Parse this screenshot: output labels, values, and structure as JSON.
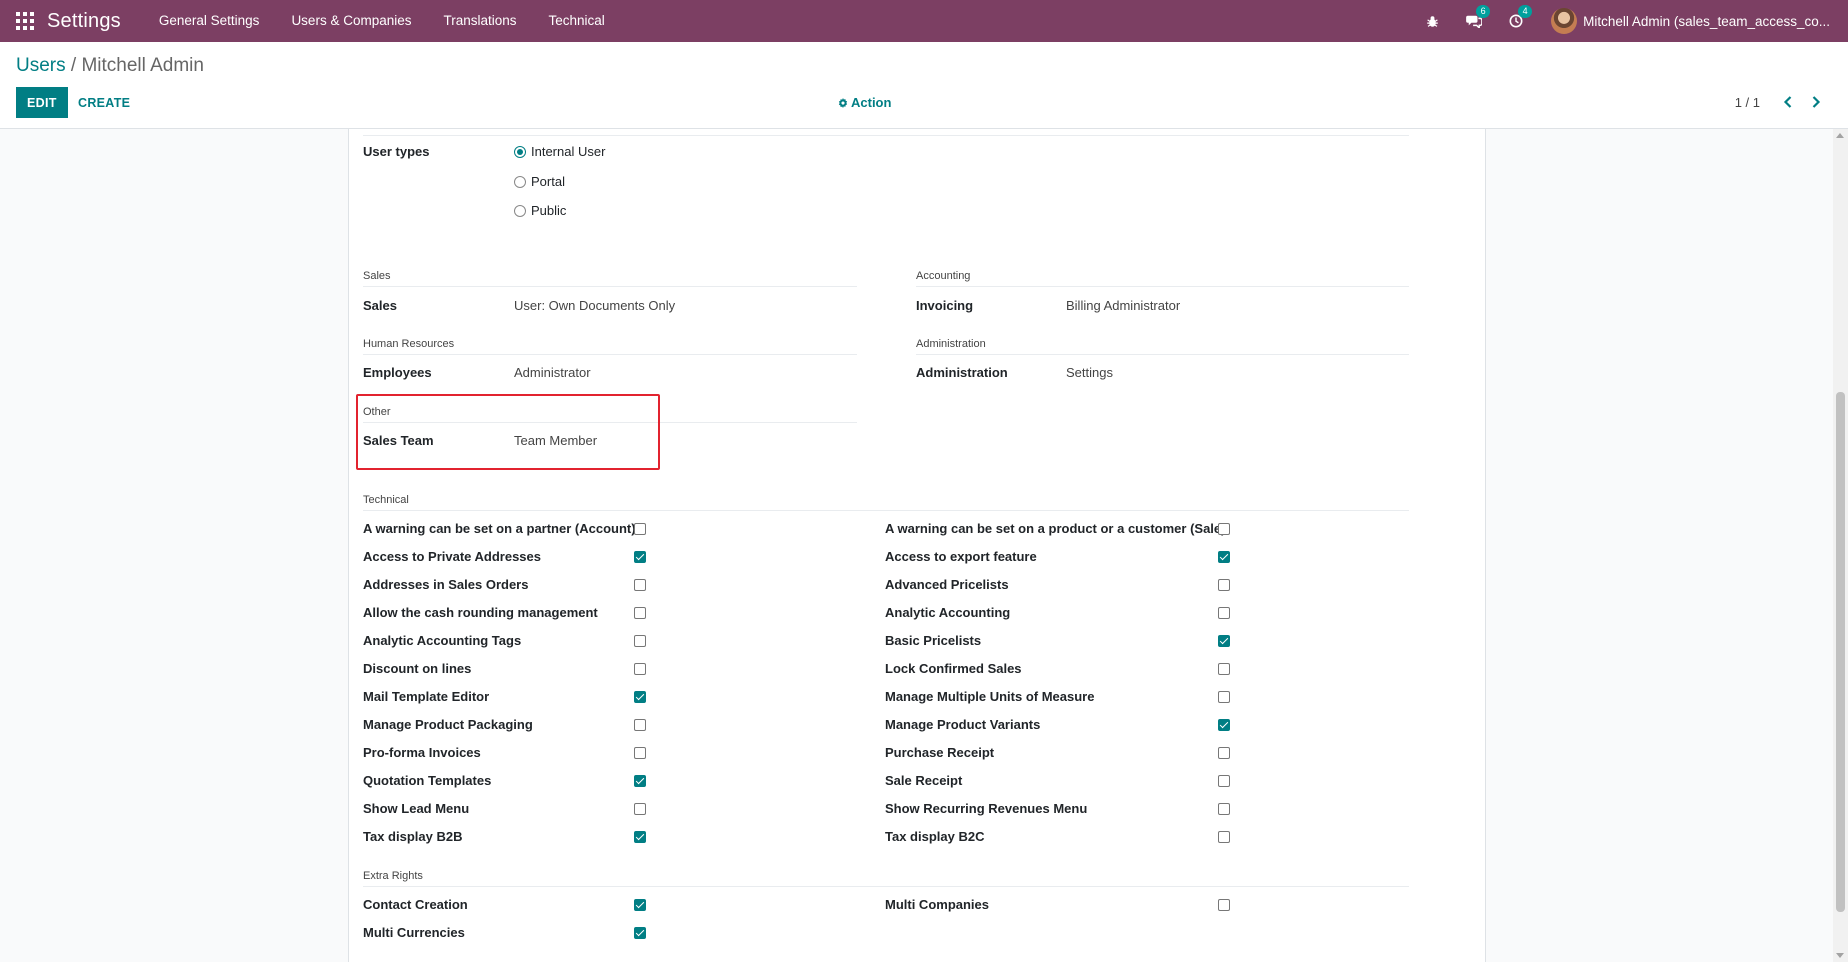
{
  "navbar": {
    "app_title": "Settings",
    "menu": [
      "General Settings",
      "Users & Companies",
      "Translations",
      "Technical"
    ],
    "chat_count": "6",
    "activity_count": "4",
    "user_name": "Mitchell Admin (sales_team_access_co..."
  },
  "control_panel": {
    "breadcrumb_parent": "Users",
    "breadcrumb_separator": " / ",
    "breadcrumb_current": "Mitchell Admin",
    "edit_label": "EDIT",
    "create_label": "CREATE",
    "action_label": "Action",
    "pager": "1 / 1"
  },
  "form": {
    "user_types": {
      "label": "User types",
      "options": [
        {
          "label": "Internal User",
          "checked": true
        },
        {
          "label": "Portal",
          "checked": false
        },
        {
          "label": "Public",
          "checked": false
        }
      ]
    },
    "groups": {
      "sales": {
        "title": "Sales",
        "label": "Sales",
        "value": "User: Own Documents Only"
      },
      "accounting": {
        "title": "Accounting",
        "label": "Invoicing",
        "value": "Billing Administrator"
      },
      "hr": {
        "title": "Human Resources",
        "label": "Employees",
        "value": "Administrator"
      },
      "administration": {
        "title": "Administration",
        "label": "Administration",
        "value": "Settings"
      },
      "other": {
        "title": "Other",
        "label": "Sales Team",
        "value": "Team Member"
      }
    },
    "technical": {
      "title": "Technical",
      "left": [
        {
          "label": "A warning can be set on a partner (Account)",
          "checked": false
        },
        {
          "label": "Access to Private Addresses",
          "checked": true
        },
        {
          "label": "Addresses in Sales Orders",
          "checked": false
        },
        {
          "label": "Allow the cash rounding management",
          "checked": false
        },
        {
          "label": "Analytic Accounting Tags",
          "checked": false
        },
        {
          "label": "Discount on lines",
          "checked": false
        },
        {
          "label": "Mail Template Editor",
          "checked": true
        },
        {
          "label": "Manage Product Packaging",
          "checked": false
        },
        {
          "label": "Pro-forma Invoices",
          "checked": false
        },
        {
          "label": "Quotation Templates",
          "checked": true
        },
        {
          "label": "Show Lead Menu",
          "checked": false
        },
        {
          "label": "Tax display B2B",
          "checked": true
        }
      ],
      "right": [
        {
          "label": "A warning can be set on a product or a customer (Sale)",
          "checked": false
        },
        {
          "label": "Access to export feature",
          "checked": true
        },
        {
          "label": "Advanced Pricelists",
          "checked": false
        },
        {
          "label": "Analytic Accounting",
          "checked": false
        },
        {
          "label": "Basic Pricelists",
          "checked": true
        },
        {
          "label": "Lock Confirmed Sales",
          "checked": false
        },
        {
          "label": "Manage Multiple Units of Measure",
          "checked": false
        },
        {
          "label": "Manage Product Variants",
          "checked": true
        },
        {
          "label": "Purchase Receipt",
          "checked": false
        },
        {
          "label": "Sale Receipt",
          "checked": false
        },
        {
          "label": "Show Recurring Revenues Menu",
          "checked": false
        },
        {
          "label": "Tax display B2C",
          "checked": false
        }
      ]
    },
    "extra_rights": {
      "title": "Extra Rights",
      "left": [
        {
          "label": "Contact Creation",
          "checked": true
        },
        {
          "label": "Multi Currencies",
          "checked": true
        }
      ],
      "right": [
        {
          "label": "Multi Companies",
          "checked": false
        }
      ]
    }
  },
  "colors": {
    "navbar": "#7c3f63",
    "primary": "#017e84",
    "highlight": "#e2232f"
  }
}
